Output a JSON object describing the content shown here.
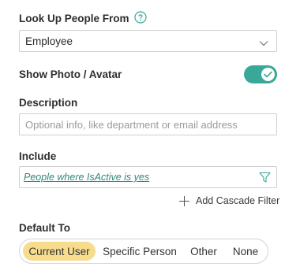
{
  "lookup": {
    "label": "Look Up People From",
    "help_icon": "question-circle-icon",
    "selected": "Employee"
  },
  "photo": {
    "label": "Show Photo / Avatar",
    "enabled": true,
    "toggle_color": "#3aa898"
  },
  "description": {
    "label": "Description",
    "placeholder": "Optional info, like department or email address",
    "value": ""
  },
  "include": {
    "label": "Include",
    "filter_text": "People where IsActive is yes",
    "filter_icon": "filter-funnel-icon"
  },
  "cascade": {
    "label": "Add Cascade Filter",
    "icon": "plus-icon"
  },
  "default_to": {
    "label": "Default To",
    "options": [
      "Current User",
      "Specific Person",
      "Other",
      "None"
    ],
    "selected": "Current User",
    "active_color": "#f6dc8c"
  }
}
